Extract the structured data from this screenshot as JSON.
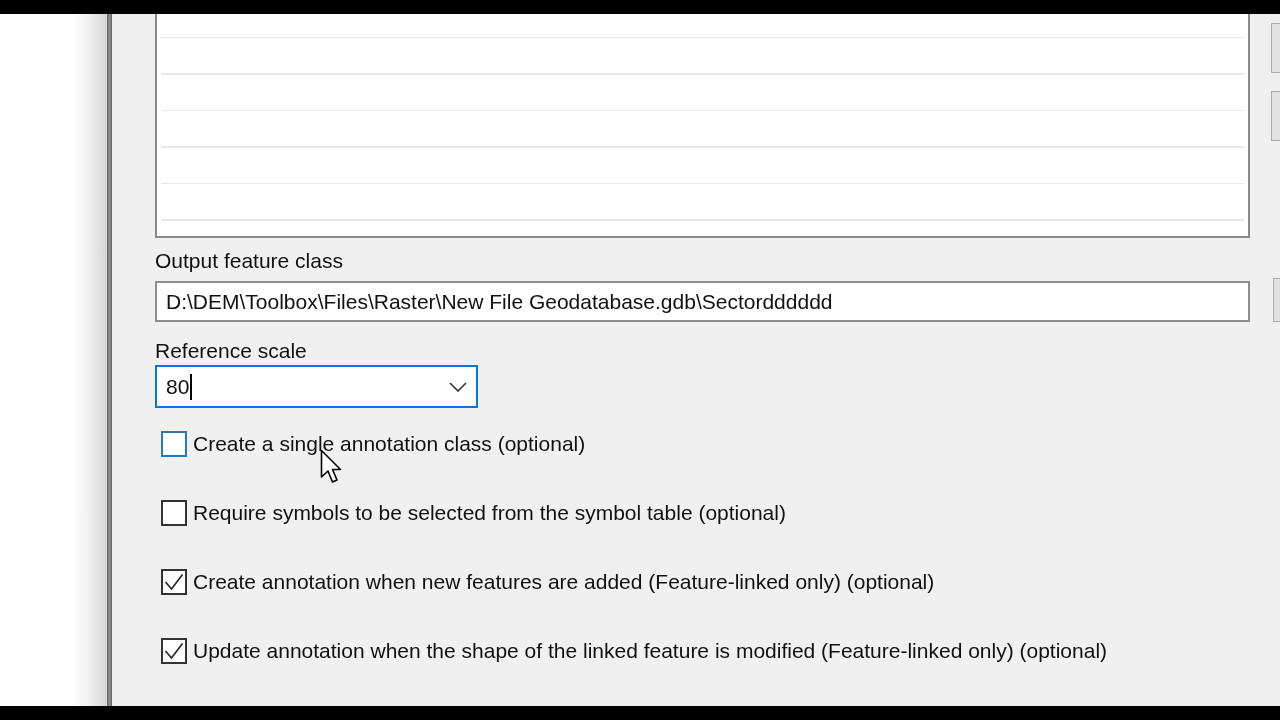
{
  "output_feature_class": {
    "label": "Output feature class",
    "value": "D:\\DEM\\Toolbox\\Files\\Raster\\New File Geodatabase.gdb\\Sectordddddd"
  },
  "reference_scale": {
    "label": "Reference scale",
    "value": "80",
    "focused": true
  },
  "options": [
    {
      "label": "Create a single annotation class (optional)",
      "checked": false,
      "hovered": true
    },
    {
      "label": "Require symbols to be selected from the symbol table (optional)",
      "checked": false,
      "hovered": false
    },
    {
      "label": "Create annotation when new features are added (Feature-linked only) (optional)",
      "checked": true,
      "hovered": false
    },
    {
      "label": "Update annotation when the shape of the linked feature is modified (Feature-linked only) (optional)",
      "checked": true,
      "hovered": false
    }
  ]
}
